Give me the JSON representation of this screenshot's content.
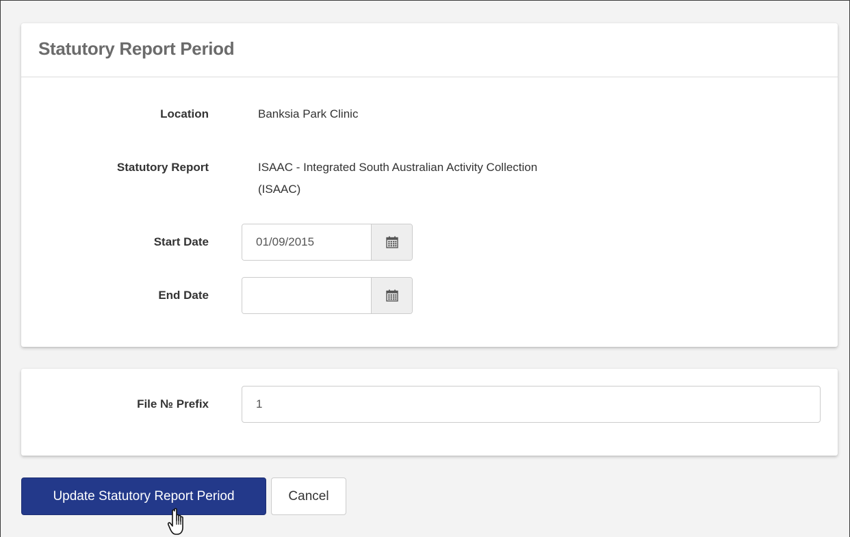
{
  "panel": {
    "title": "Statutory Report Period"
  },
  "fields": {
    "location": {
      "label": "Location",
      "value": "Banksia Park Clinic"
    },
    "statutory_report": {
      "label": "Statutory Report",
      "value_line1": "ISAAC - Integrated South Australian Activity Collection",
      "value_line2": "(ISAAC)"
    },
    "start_date": {
      "label": "Start Date",
      "value": "01/09/2015"
    },
    "end_date": {
      "label": "End Date",
      "value": ""
    },
    "file_prefix": {
      "label": "File № Prefix",
      "value": "1"
    }
  },
  "actions": {
    "update_label": "Update Statutory Report Period",
    "cancel_label": "Cancel"
  },
  "icons": {
    "date_picker": "calendar-icon",
    "pointer": "hand-pointer-icon"
  },
  "colors": {
    "primary": "#23398a",
    "title": "#6b6b6b",
    "addon_bg": "#eeeeee"
  }
}
